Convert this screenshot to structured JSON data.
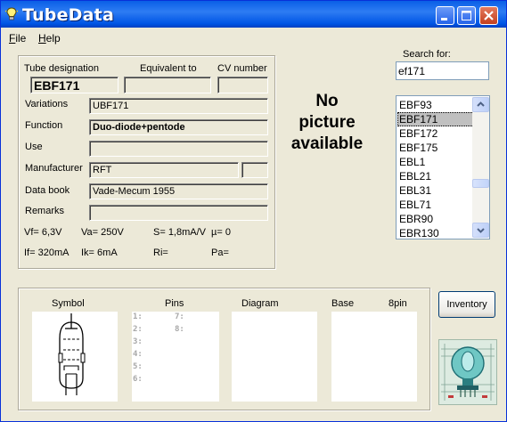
{
  "window": {
    "title": "TubeData"
  },
  "menu": {
    "items": [
      {
        "key": "F",
        "rest": "ile"
      },
      {
        "key": "H",
        "rest": "elp"
      }
    ]
  },
  "labels": {
    "tube_designation": "Tube designation",
    "equivalent_to": "Equivalent to",
    "cv_number": "CV number",
    "variations": "Variations",
    "function": "Function",
    "use": "Use",
    "manufacturer": "Manufacturer",
    "data_book": "Data book",
    "remarks": "Remarks"
  },
  "fields": {
    "tube_designation": "EBF171",
    "equivalent_to": "",
    "cv_number": "",
    "variations": "UBF171",
    "function": "Duo-diode+pentode",
    "use": "",
    "manufacturer": "RFT",
    "manufacturer_extra": "",
    "data_book": "Vade-Mecum 1955",
    "remarks": ""
  },
  "params": {
    "vf": "Vf= 6,3V",
    "va": "Va=  250V",
    "s": "S= 1,8mA/V",
    "mu": "µ=    0",
    "if": "If= 320mA",
    "ik": "Ik=   6mA",
    "ri": "Ri=",
    "pa": "Pa="
  },
  "picture_placeholder": [
    "No",
    "picture",
    "available"
  ],
  "search": {
    "label": "Search for:",
    "value": "ef171"
  },
  "tube_list": {
    "items": [
      "EBF93",
      "EBF171",
      "EBF172",
      "EBF175",
      "EBL1",
      "EBL21",
      "EBL31",
      "EBL71",
      "EBR90",
      "EBR130"
    ],
    "selected": "EBF171"
  },
  "bottom": {
    "symbol": "Symbol",
    "pins": "Pins",
    "diagram": "Diagram",
    "base": "Base",
    "base_type": "8pin",
    "pin_numbers": [
      "1:",
      "2:",
      "3:",
      "4:",
      "5:",
      "6:",
      "7:",
      "8:"
    ]
  },
  "inventory_button": "Inventory",
  "colors": {
    "titlebar": "#0A5FE6",
    "window_bg": "#ECE9D8",
    "list_selected": "#C0C0C0"
  }
}
